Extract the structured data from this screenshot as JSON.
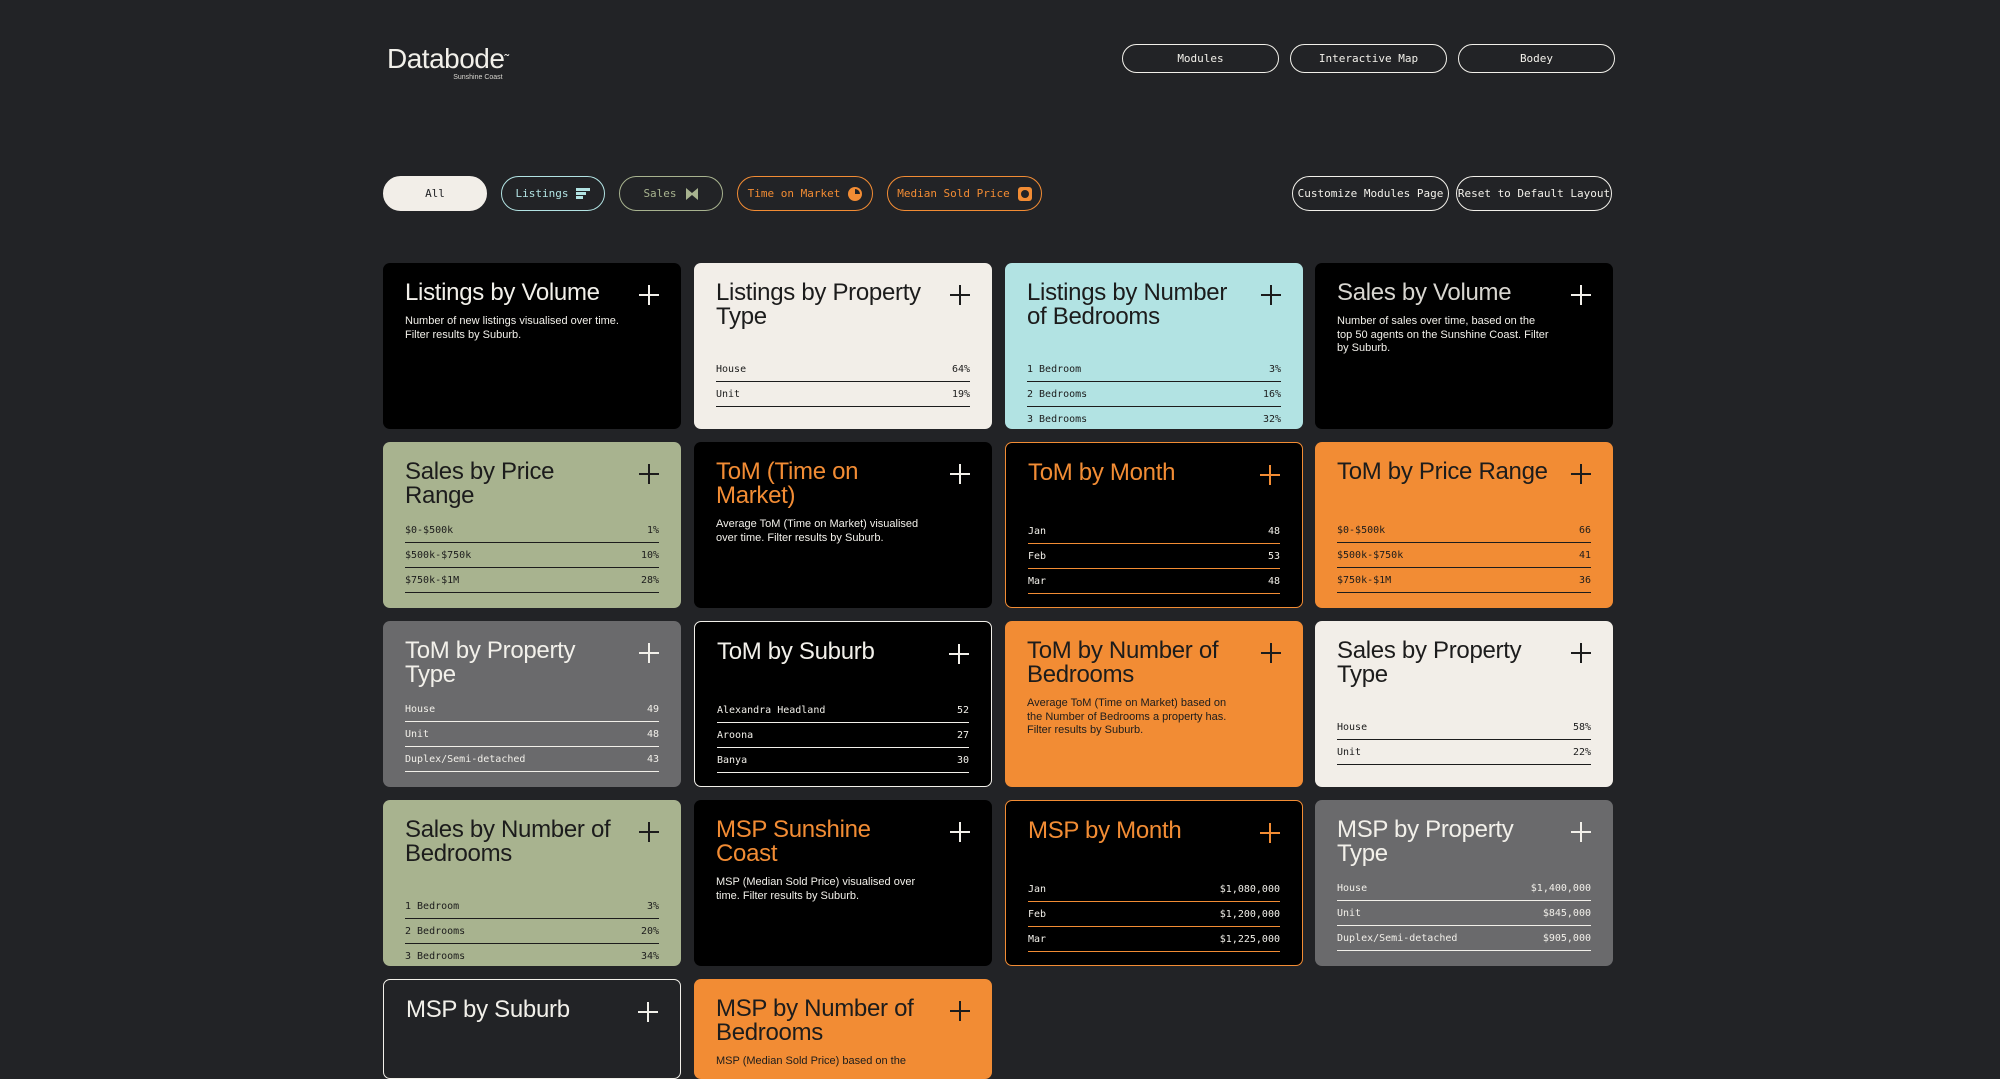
{
  "brand": {
    "name": "Databode",
    "region": "Sunshine Coast"
  },
  "topnav": [
    "Modules",
    "Interactive Map",
    "Bodey"
  ],
  "filters": {
    "all": "All",
    "listings": "Listings",
    "sales": "Sales",
    "tom": "Time on Market",
    "msp": "Median Sold Price"
  },
  "actions": {
    "customize": "Customize Modules Page",
    "reset": "Reset to Default Layout"
  },
  "colors": {
    "background": "#222326",
    "cream": "#f2eee8",
    "aqua": "#b2e3e3",
    "sage": "#a8b38f",
    "orange": "#f28c34",
    "grey": "#6a6a6c"
  },
  "cards": [
    {
      "title": "Listings by Volume",
      "desc": "Number of new listings visualised over time. Filter results by Suburb."
    },
    {
      "title": "Listings by Property Type",
      "rows": [
        [
          "House",
          "64%"
        ],
        [
          "Unit",
          "19%"
        ]
      ]
    },
    {
      "title": "Listings by Number of Bedrooms",
      "rows": [
        [
          "1 Bedroom",
          "3%"
        ],
        [
          "2 Bedrooms",
          "16%"
        ],
        [
          "3 Bedrooms",
          "32%"
        ]
      ]
    },
    {
      "title": "Sales by Volume",
      "desc": "Number of sales over time, based on the top 50 agents on the Sunshine Coast. Filter by Suburb."
    },
    {
      "title": "Sales by Price Range",
      "rows": [
        [
          "$0-$500k",
          "1%"
        ],
        [
          "$500k-$750k",
          "10%"
        ],
        [
          "$750k-$1M",
          "28%"
        ]
      ]
    },
    {
      "title": "ToM (Time on Market)",
      "desc": "Average ToM (Time on Market) visualised over time. Filter results by Suburb."
    },
    {
      "title": "ToM by Month",
      "rows": [
        [
          "Jan",
          "48"
        ],
        [
          "Feb",
          "53"
        ],
        [
          "Mar",
          "48"
        ]
      ]
    },
    {
      "title": "ToM by Price Range",
      "rows": [
        [
          "$0-$500k",
          "66"
        ],
        [
          "$500k-$750k",
          "41"
        ],
        [
          "$750k-$1M",
          "36"
        ]
      ]
    },
    {
      "title": "ToM by Property Type",
      "rows": [
        [
          "House",
          "49"
        ],
        [
          "Unit",
          "48"
        ],
        [
          "Duplex/Semi-detached",
          "43"
        ]
      ]
    },
    {
      "title": "ToM by Suburb",
      "rows": [
        [
          "Alexandra Headland",
          "52"
        ],
        [
          "Aroona",
          "27"
        ],
        [
          "Banya",
          "30"
        ]
      ]
    },
    {
      "title": "ToM by Number of Bedrooms",
      "desc": "Average ToM (Time on Market) based on the Number of Bedrooms a property has. Filter results by Suburb."
    },
    {
      "title": "Sales by Property Type",
      "rows": [
        [
          "House",
          "58%"
        ],
        [
          "Unit",
          "22%"
        ]
      ]
    },
    {
      "title": "Sales by Number of Bedrooms",
      "rows": [
        [
          "1 Bedroom",
          "3%"
        ],
        [
          "2 Bedrooms",
          "20%"
        ],
        [
          "3 Bedrooms",
          "34%"
        ]
      ]
    },
    {
      "title": "MSP Sunshine Coast",
      "desc": "MSP (Median Sold Price) visualised over time. Filter results by Suburb."
    },
    {
      "title": "MSP by Month",
      "rows": [
        [
          "Jan",
          "$1,080,000"
        ],
        [
          "Feb",
          "$1,200,000"
        ],
        [
          "Mar",
          "$1,225,000"
        ]
      ]
    },
    {
      "title": "MSP by Property Type",
      "rows": [
        [
          "House",
          "$1,400,000"
        ],
        [
          "Unit",
          "$845,000"
        ],
        [
          "Duplex/Semi-detached",
          "$905,000"
        ]
      ]
    },
    {
      "title": "MSP by Suburb"
    },
    {
      "title": "MSP by Number of Bedrooms",
      "desc": "MSP (Median Sold Price) based on the"
    }
  ]
}
